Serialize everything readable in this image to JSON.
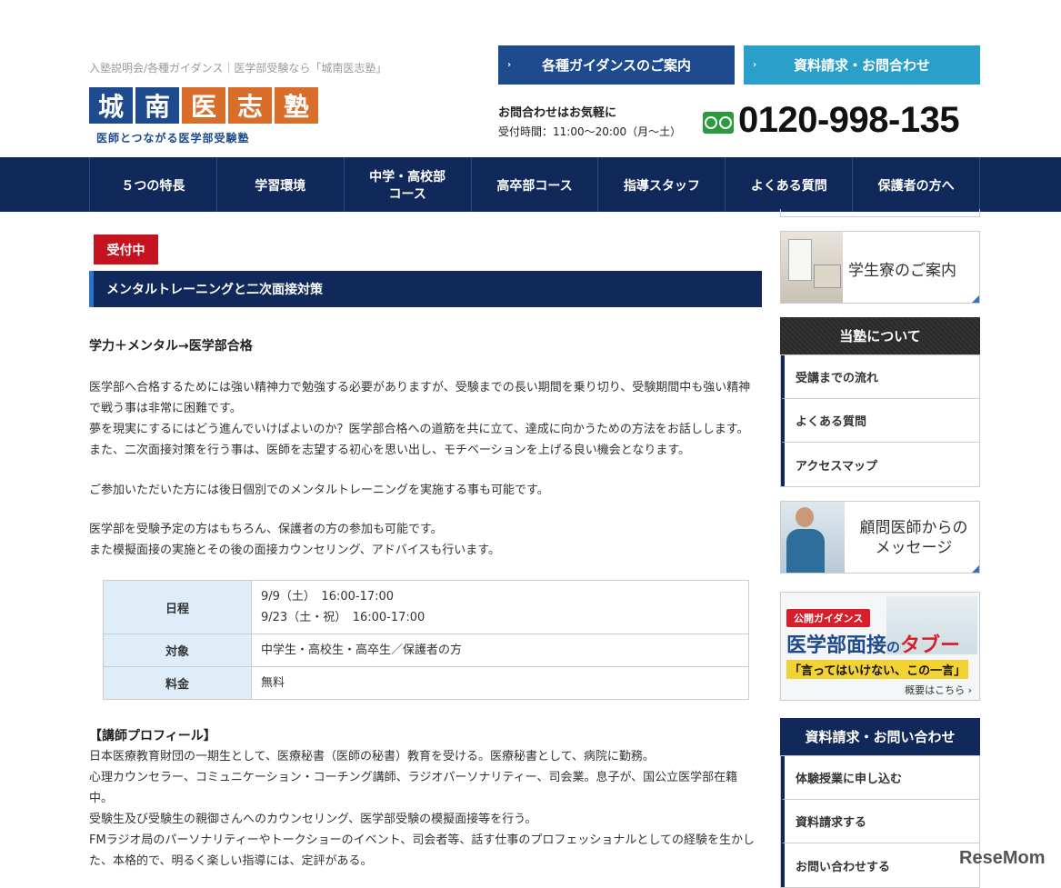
{
  "header": {
    "tagline": "入塾説明会/各種ガイダンス｜医学部受験なら「城南医志塾」",
    "logo_chars": [
      "城",
      "南",
      "医",
      "志",
      "塾"
    ],
    "logo_sub": "医師とつながる医学部受験塾",
    "btn_guidance": "各種ガイダンスのご案内",
    "btn_request": "資料請求・お問合わせ",
    "contact_title": "お問合わせはお気軽に",
    "contact_hours": "受付時間：11:00～20:00（月～土）",
    "phone": "0120-998-135"
  },
  "nav": {
    "items": [
      "５つの特長",
      "学習環境",
      "中学・高校部\nコース",
      "高卒部コース",
      "指導スタッフ",
      "よくある質問",
      "保護者の方へ"
    ]
  },
  "main": {
    "badge": "受付中",
    "title": "メンタルトレーニングと二次面接対策",
    "lead": "学力＋メンタル→医学部合格",
    "p1": [
      "医学部へ合格するためには強い精神力で勉強する必要がありますが、受験までの長い期間を乗り切り、受験期間中も強い精神",
      "で戦う事は非常に困難です。",
      "夢を現実にするにはどう進んでいけばよいのか？医学部合格への道筋を共に立て、達成に向かうための方法をお話しします。",
      "また、二次面接対策を行う事は、医師を志望する初心を思い出し、モチベーションを上げる良い機会となります。"
    ],
    "p2": "ご参加いただいた方には後日個別でのメンタルトレーニングを実施する事も可能です。",
    "p3": [
      "医学部を受験予定の方はもちろん、保護者の方の参加も可能です。",
      "また模擬面接の実施とその後の面接カウンセリング、アドバイスも行います。"
    ],
    "table": {
      "schedule_label": "日程",
      "schedule_1": "9/9（土）　16:00-17:00",
      "schedule_2": "9/23（土・祝）　16:00-17:00",
      "target_label": "対象",
      "target": "中学生・高校生・高卒生／保護者の方",
      "fee_label": "料金",
      "fee": "無料"
    },
    "profile_title": "【講師プロフィール】",
    "profile": [
      "日本医療教育財団の一期生として、医療秘書（医師の秘書）教育を受ける。医療秘書として、病院に勤務。",
      "心理カウンセラー、コミュニケーション・コーチング講師、ラジオパーソナリティー、司会業。息子が、国公立医学部在籍",
      "中。",
      "受験生及び受験生の親御さんへのカウンセリング、医学部受験の模擬面接等を行う。",
      "FMラジオ局のパーソナリティーやトークショーのイベント、司会者等、話す仕事のプロフェッショナルとしての経験を生かし",
      "た、本格的で、明るく楽しい指導には、定評がある。"
    ]
  },
  "sidebar": {
    "dorm_banner": "学生寮のご案内",
    "about_head": "当塾について",
    "about_items": [
      "受講までの流れ",
      "よくある質問",
      "アクセスマップ"
    ],
    "advisor_banner_1": "顧問医師からの",
    "advisor_banner_2": "メッセージ",
    "tabu_tag": "公開ガイダンス",
    "tabu_title_a": "医学部面接",
    "tabu_title_b": "の",
    "tabu_title_c": "タブー",
    "tabu_quote": "「言ってはいけない、この一言」",
    "tabu_more": "概要はこちら ›",
    "request_head": "資料請求・お問い合わせ",
    "request_items": [
      "体験授業に申し込む",
      "資料請求する",
      "お問い合わせする"
    ]
  },
  "watermark": "ReseMom",
  "colors": {
    "navy": "#10295a",
    "blue": "#1e4a8e",
    "teal": "#2a9fc9",
    "orange": "#d86e2a",
    "red": "#c4121e"
  }
}
